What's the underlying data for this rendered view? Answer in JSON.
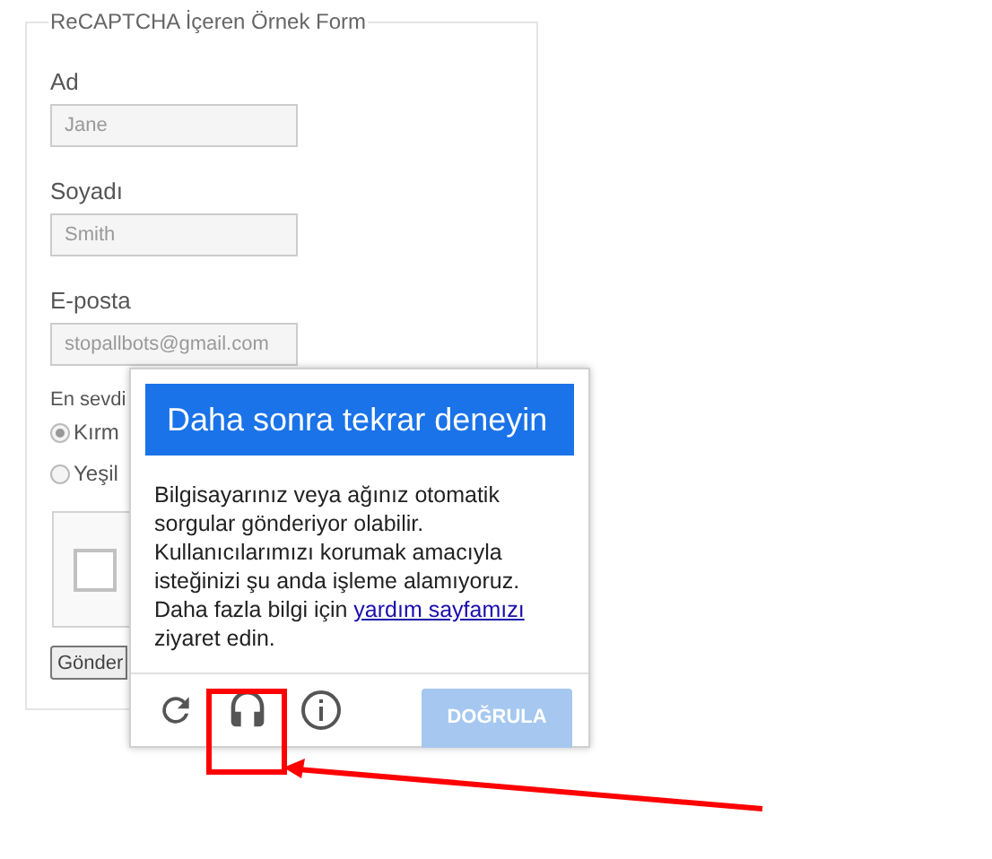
{
  "form": {
    "legend": "ReCAPTCHA İçeren Örnek Form",
    "fields": [
      {
        "label": "Ad",
        "placeholder": "Jane"
      },
      {
        "label": "Soyadı",
        "placeholder": "Smith"
      },
      {
        "label": "E-posta",
        "placeholder": "stopallbots@gmail.com"
      }
    ],
    "question": "En sevdi",
    "radios": [
      {
        "label": "Kırm",
        "selected": true
      },
      {
        "label": "Yeşil",
        "selected": false
      }
    ],
    "captcha": {
      "checked": false
    },
    "submit": "Gönder"
  },
  "challenge": {
    "title": "Daha sonra tekrar deneyin",
    "message": "Bilgisayarınız veya ağınız otomatik sorgular gönderiyor olabilir. Kullanıcılarımızı korumak amacıyla isteğinizi şu anda işleme alamıyoruz. Daha fazla bilgi için",
    "link": "yardım sayfamızı",
    "message_end": "ziyaret edin.",
    "verify": "DOĞRULA"
  }
}
